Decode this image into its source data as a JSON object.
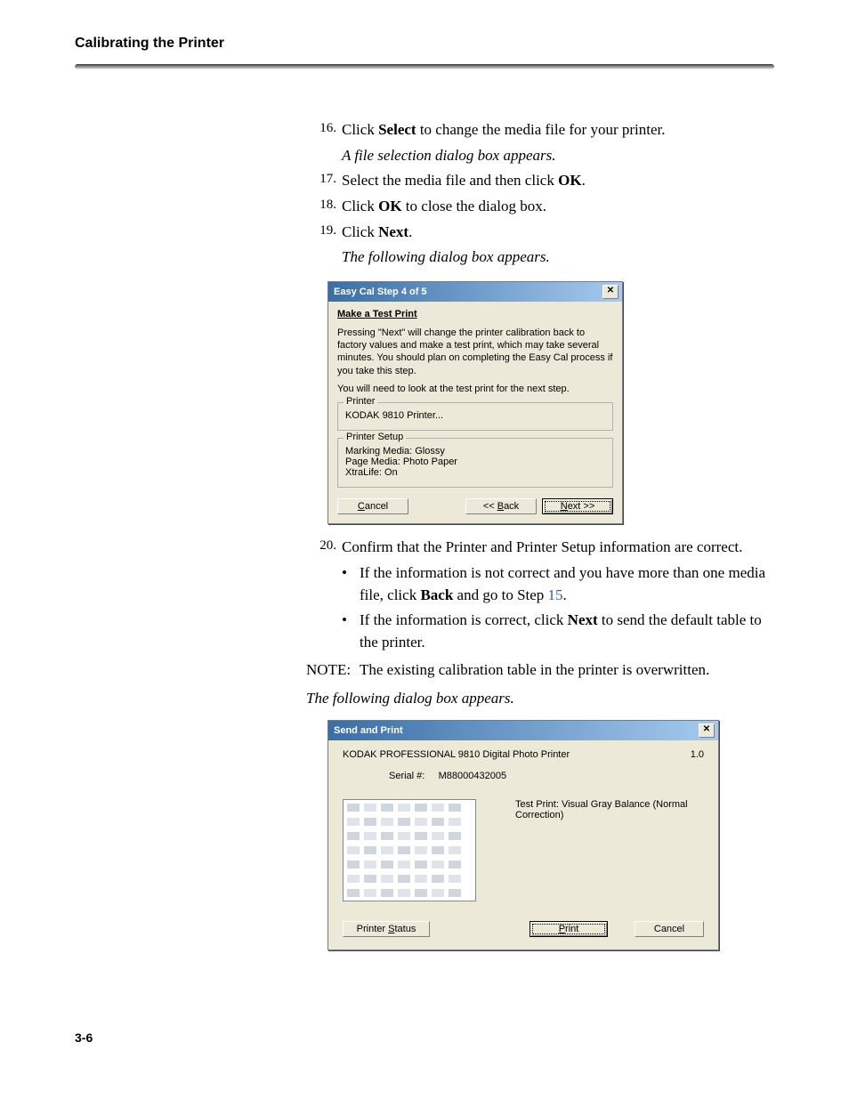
{
  "header": {
    "title": "Calibrating the Printer"
  },
  "steps": {
    "s16": {
      "num": "16.",
      "pre": "Click ",
      "bold": "Select",
      "post": " to change the media file for your printer."
    },
    "s16_sub": "A file selection dialog box appears.",
    "s17": {
      "num": "17.",
      "pre": "Select the media file and then click ",
      "bold": "OK",
      "post": "."
    },
    "s18": {
      "num": "18.",
      "pre": "Click ",
      "bold": "OK",
      "post": " to close the dialog box."
    },
    "s19": {
      "num": "19.",
      "pre": "Click ",
      "bold": "Next",
      "post": "."
    },
    "s19_sub": "The following dialog box appears.",
    "s20": {
      "num": "20.",
      "text": "Confirm that the Printer and Printer Setup information are correct."
    },
    "b1": {
      "pre": "If the information is not correct and you have more than one media file, click ",
      "bold": "Back",
      "mid": " and go to Step ",
      "link": "15",
      "post": "."
    },
    "b2": {
      "pre": "If the information is correct, click ",
      "bold": "Next",
      "post": " to send the default table to the printer."
    },
    "note": {
      "label": "NOTE:",
      "text": "The existing calibration table in the printer is overwritten."
    },
    "follow": "The following dialog box appears."
  },
  "dialog1": {
    "title": "Easy Cal Step 4 of 5",
    "heading": "Make a Test Print",
    "p1": "Pressing \"Next\" will change the printer calibration back to factory values and make a test print, which may take several minutes.  You should plan on completing the Easy Cal process if you take this step.",
    "p2": "You will need to look at the test print for the next step.",
    "printer_group": "Printer",
    "printer_name": "KODAK 9810 Printer...",
    "setup_group": "Printer Setup",
    "setup_l1": "Marking Media: Glossy",
    "setup_l2": "Page Media: Photo Paper",
    "setup_l3": "XtraLife: On",
    "btn_cancel": "Cancel",
    "btn_back": "<< Back",
    "btn_next": "Next >>",
    "btn_cancel_u": "C",
    "btn_back_u": "B",
    "btn_next_u": "N"
  },
  "dialog2": {
    "title": "Send and Print",
    "printer": "KODAK PROFESSIONAL 9810 Digital Photo Printer",
    "version": "1.0",
    "serial_label": "Serial #:",
    "serial_value": "M88000432005",
    "desc": "Test Print: Visual Gray Balance (Normal Correction)",
    "btn_status": "Printer Status",
    "btn_status_u": "S",
    "btn_print": "Print",
    "btn_print_u": "P",
    "btn_cancel": "Cancel"
  },
  "footer": {
    "page": "3-6"
  }
}
